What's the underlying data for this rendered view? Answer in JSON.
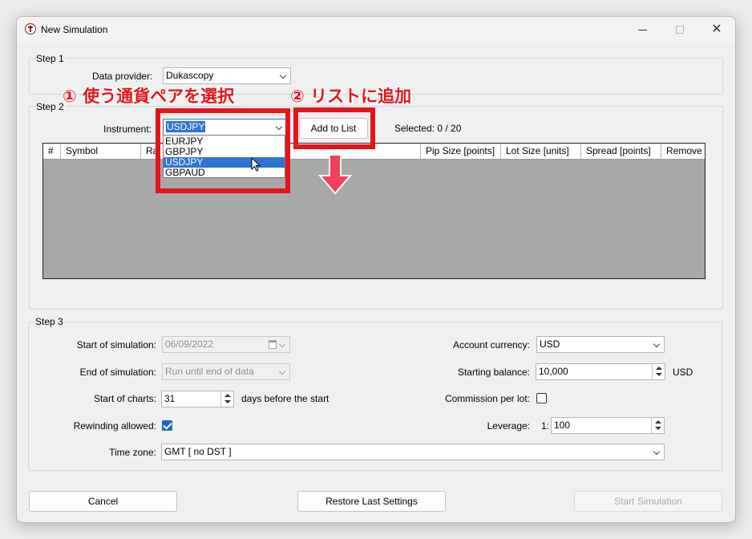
{
  "window": {
    "title": "New Simulation"
  },
  "step1": {
    "label": "Step 1",
    "data_provider_label": "Data provider:",
    "data_provider_value": "Dukascopy"
  },
  "step2": {
    "label": "Step 2",
    "instrument_label": "Instrument:",
    "instrument_value": "USDJPY",
    "add_button": "Add to List",
    "selected_text": "Selected: 0 / 20",
    "columns": [
      "#",
      "Symbol",
      "Ra",
      "Pip Size [points]",
      "Lot Size [units]",
      "Spread [points]",
      "Remove"
    ],
    "dropdown_options": [
      "EURJPY",
      "GBPJPY",
      "USDJPY",
      "GBPAUD"
    ],
    "dropdown_selected_index": 2
  },
  "step3": {
    "label": "Step 3",
    "start_sim_label": "Start of simulation:",
    "start_sim_value": "06/09/2022",
    "end_sim_label": "End of simulation:",
    "end_sim_value": "Run until end of data",
    "start_charts_label": "Start of charts:",
    "start_charts_value": "31",
    "start_charts_suffix": "days before the start",
    "rewinding_label": "Rewinding allowed:",
    "rewinding_checked": true,
    "timezone_label": "Time zone:",
    "timezone_value": "GMT [ no DST ]",
    "account_currency_label": "Account currency:",
    "account_currency_value": "USD",
    "starting_balance_label": "Starting balance:",
    "starting_balance_value": "10,000",
    "starting_balance_unit": "USD",
    "commission_label": "Commission per lot:",
    "commission_checked": false,
    "leverage_label": "Leverage:",
    "leverage_prefix": "1:",
    "leverage_value": "100"
  },
  "footer": {
    "cancel": "Cancel",
    "restore": "Restore Last Settings",
    "start": "Start Simulation"
  },
  "annotations": {
    "step_one": "① 使う通貨ペアを選択",
    "step_two": "② リストに追加",
    "color": "#e5141c",
    "arrow_color": "#f0405a"
  }
}
